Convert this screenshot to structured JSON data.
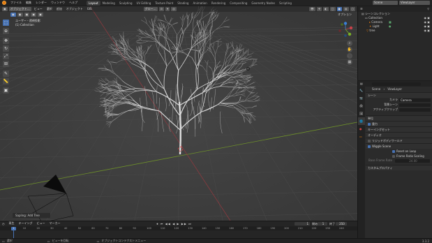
{
  "topbar": {
    "menus": [
      "ファイル",
      "編集",
      "レンダー",
      "ウィンドウ",
      "ヘルプ"
    ],
    "tabs": [
      "Layout",
      "Modeling",
      "Sculpting",
      "UV Editing",
      "Texture Paint",
      "Shading",
      "Animation",
      "Rendering",
      "Compositing",
      "Geometry Nodes",
      "Scripting"
    ],
    "active_tab": "Layout",
    "scene_label": "Scene",
    "view_layer_label": "ViewLayer"
  },
  "viewport": {
    "mode": "オブジェクト…",
    "menus": [
      "ビュー",
      "選択",
      "追加",
      "オブジェクト",
      "GIS"
    ],
    "orientation": "グロー…",
    "options": "オプション",
    "view_name": "ユーザー・透視投影",
    "collection_name": "(1) Collection",
    "last_op": "Sapling: Add Tree",
    "gizmo_labels": [
      "X",
      "Y",
      "Z"
    ]
  },
  "outliner": {
    "root": "シーンコレクション",
    "items": [
      "Collection",
      "Camera",
      "Light",
      "tree"
    ]
  },
  "properties": {
    "breadcrumb_scene": "Scene",
    "breadcrumb_layer": "ViewLayer",
    "section_scene": "シーン",
    "camera_label": "カメラ",
    "camera_value": "Camera",
    "bg_scene_label": "背景シーン",
    "active_clip_label": "アクティブクリップ",
    "sections": [
      "単位",
      "重力",
      "キーイングセット",
      "オーディオ",
      "リジッドボディワールド"
    ],
    "gravity_checked": true,
    "wiggle_scene": "Wiggle Scene",
    "reset_on_loop": "Reset on Loop",
    "frame_ratio": "Frame Ratio Scaling",
    "base_frame_rate": "Base Frame Rate",
    "base_frame_rate_value": "24.00",
    "custom_props": "カスタムプロパティ"
  },
  "timeline": {
    "menus": [
      "再生",
      "キーイング",
      "ビュー",
      "マーカー"
    ],
    "current_frame": "1",
    "start_label": "開始",
    "start_value": "1",
    "end_label": "終了",
    "end_value": "250",
    "ticks": [
      "10",
      "20",
      "30",
      "40",
      "50",
      "60",
      "70",
      "80",
      "90",
      "100",
      "110",
      "120",
      "130",
      "140",
      "150",
      "160",
      "170",
      "180",
      "190",
      "200",
      "210",
      "220",
      "230",
      "240",
      "250"
    ],
    "ruler_current": "1"
  },
  "status": {
    "left": "選択",
    "middle": "ビューを回転",
    "right": "オブジェクトコンテクストメニュー",
    "version": "3.3.2"
  },
  "colors": {
    "accent": "#4772b3",
    "x_axis": "#c8424a",
    "y_axis": "#79b127",
    "viewport_bg": "#3d3d3d",
    "orange": "#e87d0d"
  },
  "icons": [
    "blender-logo-icon",
    "select-cursor-icon",
    "cursor-icon",
    "move-icon",
    "rotate-icon",
    "scale-icon",
    "transform-icon",
    "annotate-icon",
    "measure-icon",
    "add-cube-icon",
    "zoom-icon",
    "hand-icon",
    "camera-icon",
    "grid-icon",
    "eye-icon",
    "camera-render-icon"
  ]
}
